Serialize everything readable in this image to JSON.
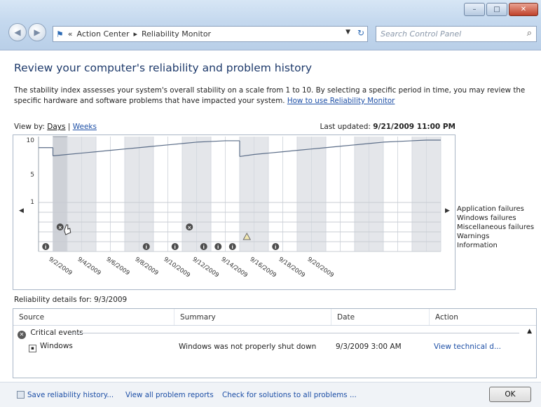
{
  "nav": {
    "breadcrumb": [
      "Action Center",
      "Reliability Monitor"
    ],
    "search_placeholder": "Search Control Panel"
  },
  "heading": "Review your computer's reliability and problem history",
  "description": {
    "text": "The stability index assesses your system's overall stability on a scale from 1 to 10. By selecting a specific period in time, you may review the specific hardware and software problems that have impacted your system.",
    "link": "How to use Reliability Monitor"
  },
  "view_by": {
    "label": "View by:",
    "days": "Days",
    "separator": "|",
    "weeks": "Weeks"
  },
  "last_updated": {
    "label": "Last updated:",
    "value": "9/21/2009 11:00 PM"
  },
  "chart_data": {
    "type": "line",
    "y_ticks": [
      "10",
      "5",
      "1"
    ],
    "ylim": [
      1,
      10
    ],
    "stability_index": [
      8.8,
      7.6,
      7.8,
      8.0,
      8.2,
      8.4,
      8.6,
      8.8,
      9.0,
      9.2,
      9.4,
      9.6,
      9.7,
      9.8,
      7.5,
      7.8,
      8.0,
      8.2,
      8.4,
      8.6,
      8.8,
      9.0,
      9.2,
      9.4,
      9.6,
      9.7,
      9.8,
      9.9
    ],
    "date_labels": [
      "9/2/2009",
      "9/4/2009",
      "9/6/2009",
      "9/8/2009",
      "9/10/2009",
      "9/12/2009",
      "9/14/2009",
      "9/16/2009",
      "9/18/2009",
      "9/20/2009"
    ],
    "selected_day": 1,
    "legend": [
      "Application failures",
      "Windows failures",
      "Miscellaneous failures",
      "Warnings",
      "Information"
    ],
    "events": [
      {
        "day": 1,
        "row": 2,
        "kind": "error"
      },
      {
        "day": 10,
        "row": 2,
        "kind": "error"
      },
      {
        "day": 14,
        "row": 3,
        "kind": "warning"
      },
      {
        "day": 0,
        "row": 4,
        "kind": "info"
      },
      {
        "day": 7,
        "row": 4,
        "kind": "info"
      },
      {
        "day": 9,
        "row": 4,
        "kind": "info"
      },
      {
        "day": 11,
        "row": 4,
        "kind": "info"
      },
      {
        "day": 12,
        "row": 4,
        "kind": "info"
      },
      {
        "day": 13,
        "row": 4,
        "kind": "info"
      },
      {
        "day": 16,
        "row": 4,
        "kind": "info"
      }
    ]
  },
  "details": {
    "label": "Reliability details for: 9/3/2009",
    "columns": [
      "Source",
      "Summary",
      "Date",
      "Action"
    ],
    "group": "Critical events",
    "row": {
      "source": "Windows",
      "summary": "Windows was not properly shut down",
      "date": "9/3/2009 3:00 AM",
      "action": "View technical d..."
    }
  },
  "footer": {
    "save": "Save reliability history...",
    "view_all": "View all problem reports",
    "check": "Check for solutions to all problems ...",
    "ok": "OK"
  }
}
